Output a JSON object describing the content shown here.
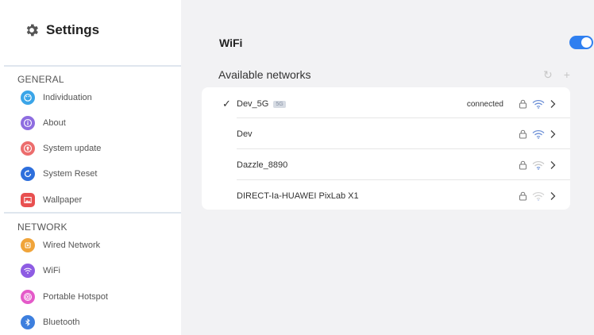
{
  "app": {
    "title": "Settings"
  },
  "sidebar": {
    "sections": [
      {
        "heading": "GENERAL",
        "items": [
          {
            "label": "Individuation",
            "icon": "palette-icon",
            "color": "#3aa5e8"
          },
          {
            "label": "About",
            "icon": "info-icon",
            "color": "#8e6de0"
          },
          {
            "label": "System update",
            "icon": "update-icon",
            "color": "#ec6d6d"
          },
          {
            "label": "System Reset",
            "icon": "reset-icon",
            "color": "#2e6fdc"
          },
          {
            "label": "Wallpaper",
            "icon": "wallpaper-icon",
            "color": "#e85050"
          }
        ]
      },
      {
        "heading": "NETWORK",
        "items": [
          {
            "label": "Wired Network",
            "icon": "wired-network-icon",
            "color": "#f0a43a"
          },
          {
            "label": "WiFi",
            "icon": "wifi-icon",
            "color": "#8e5ce3"
          },
          {
            "label": "Portable Hotspot",
            "icon": "hotspot-icon",
            "color": "#e45ac9"
          },
          {
            "label": "Bluetooth",
            "icon": "bluetooth-icon",
            "color": "#3d7fde"
          }
        ]
      }
    ]
  },
  "wifi": {
    "title": "WiFi",
    "enabled": true,
    "accent_color": "#2f7ff0",
    "available_title": "Available networks",
    "actions": {
      "refresh_icon": "refresh-icon",
      "add_icon": "add-icon"
    },
    "networks": [
      {
        "name": "Dev_5G",
        "tag": "5G",
        "connected": true,
        "status": "connected",
        "secured": true,
        "signal": "strong"
      },
      {
        "name": "Dev",
        "tag": "",
        "connected": false,
        "status": "",
        "secured": true,
        "signal": "strong"
      },
      {
        "name": "Dazzle_8890",
        "tag": "",
        "connected": false,
        "status": "",
        "secured": true,
        "signal": "weak"
      },
      {
        "name": "DIRECT-Ia-HUAWEI PixLab X1",
        "tag": "",
        "connected": false,
        "status": "",
        "secured": true,
        "signal": "weak"
      }
    ]
  }
}
